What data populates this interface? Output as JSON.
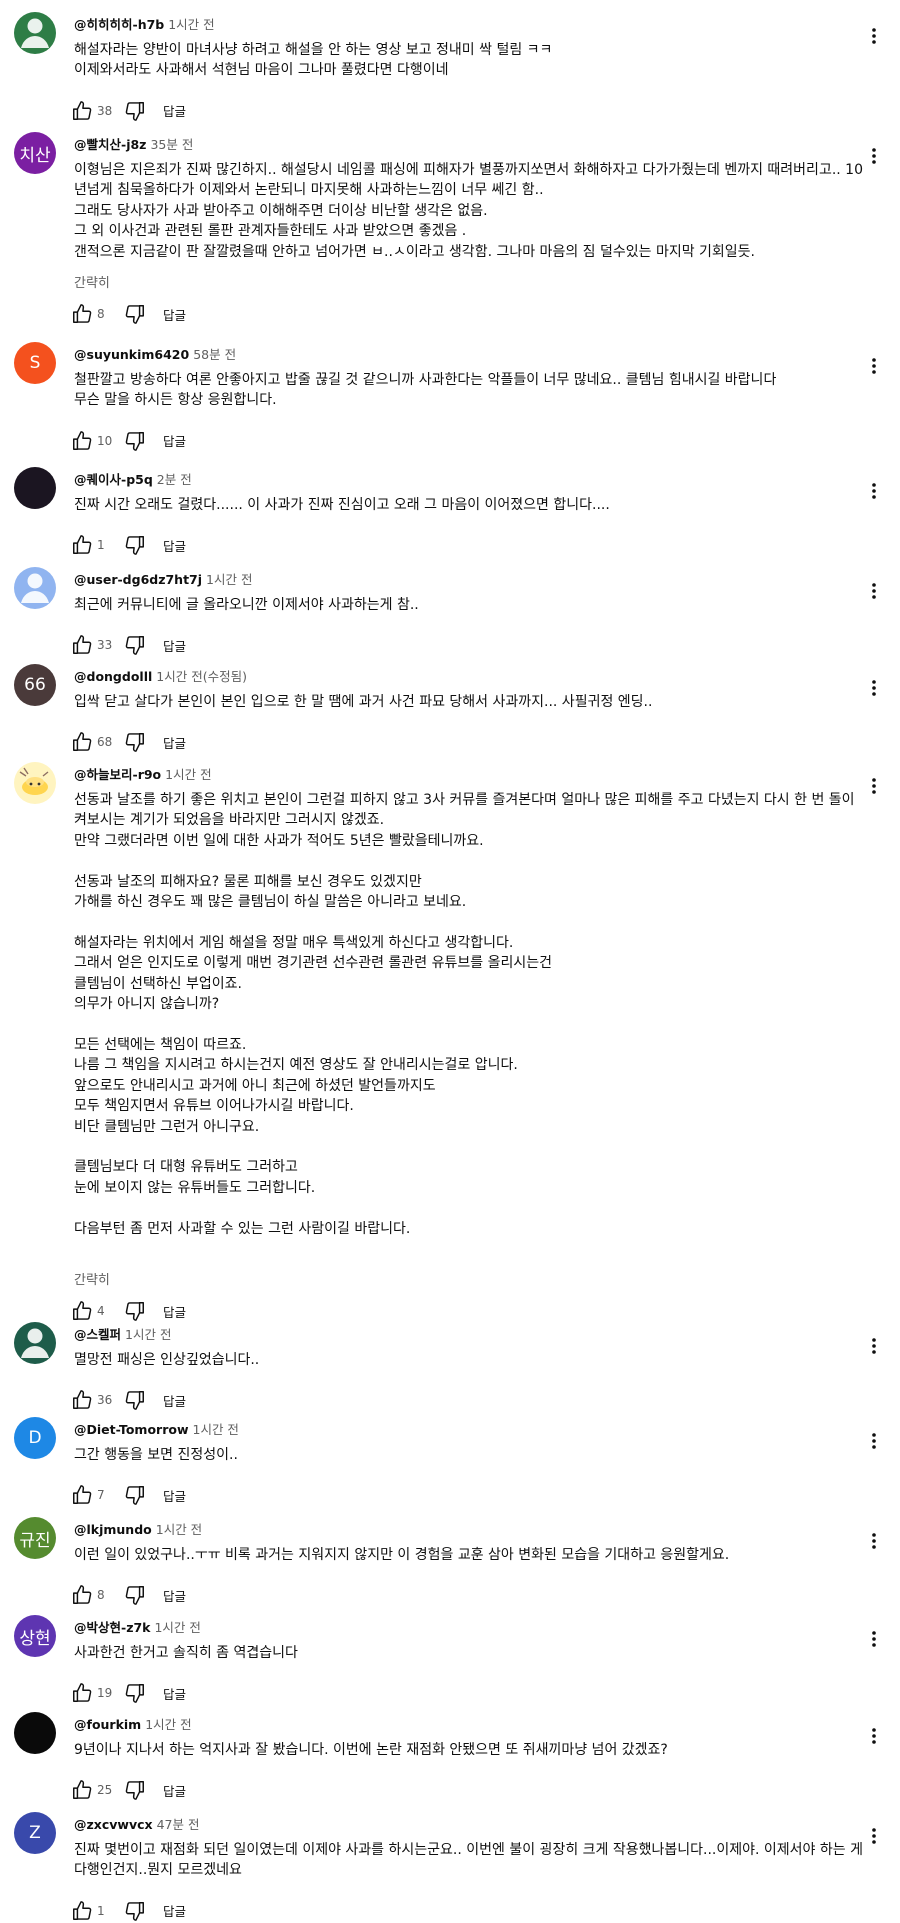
{
  "ui": {
    "reply_label": "답글",
    "show_less_label": "간략히"
  },
  "comments": [
    {
      "handle": "@히히히히-h7b",
      "time": "1시간 전",
      "avatar_text": "",
      "avatar_color": "#2e7d46",
      "avatar_icon": "person-icon",
      "text": "해설자라는 양반이 마녀사냥 하려고 해설을 안 하는 영상 보고 정내미 싹 털림 ㅋㅋ\n이제와서라도 사과해서 석현님 마음이 그나마 풀렸다면 다행이네",
      "likes": "38",
      "show_less": false
    },
    {
      "handle": "@빨치산-j8z",
      "time": "35분 전",
      "avatar_text": "치산",
      "avatar_color": "#7b1fa2",
      "avatar_icon": "",
      "text": "이형님은 지은죄가 진짜 많긴하지.. 해설당시 네임콜 패싱에 피해자가 별풍까지쏘면서 화해하자고 다가가줬는데 벤까지 때려버리고.. 10년넘게 침묵올하다가 이제와서 논란되니 마지못해 사과하는느낌이 너무 쎄긴 함..\n그래도 당사자가 사과 받아주고 이해해주면 더이상 비난할 생각은 없음.\n그 외 이사건과 관련된 롤판 관계자들한테도 사과 받았으면 좋겠음 .\n갠적으론 지금같이 판 잘깔렸을때 안하고 넘어가면 ㅂ..ㅅ이라고 생각함. 그나마 마음의 짐 덜수있는 마지막 기회일듯.",
      "likes": "8",
      "show_less": true
    },
    {
      "handle": "@suyunkim6420",
      "time": "58분 전",
      "avatar_text": "S",
      "avatar_color": "#f4511e",
      "avatar_icon": "",
      "text": "철판깔고 방송하다 여론 안좋아지고 밥줄 끊길 것 같으니까 사과한다는 악플들이 너무 많네요.. 클템님 힘내시길 바랍니다\n무슨 말을 하시든 항상 응원합니다.",
      "likes": "10",
      "show_less": false
    },
    {
      "handle": "@퀘이사-p5q",
      "time": "2분 전",
      "avatar_text": "",
      "avatar_color": "#1b1521",
      "avatar_icon": "",
      "text": "진짜 시간 오래도 걸렸다...... 이 사과가 진짜 진심이고 오래 그 마음이 이어졌으면 합니다....",
      "likes": "1",
      "show_less": false
    },
    {
      "handle": "@user-dg6dz7ht7j",
      "time": "1시간 전",
      "avatar_text": "",
      "avatar_color": "#90b4f0",
      "avatar_icon": "person-icon",
      "text": "최근에 커뮤니티에 글 올라오니깐 이제서야 사과하는게 참..",
      "likes": "33",
      "show_less": false
    },
    {
      "handle": "@dongdolll",
      "time": "1시간 전(수정됨)",
      "avatar_text": "66",
      "avatar_color": "#4a3a3a",
      "avatar_icon": "",
      "text": "입싹 닫고 살다가 본인이 본인 입으로 한 말 땜에 과거 사건 파묘 당해서 사과까지... 사필귀정 엔딩..",
      "likes": "68",
      "show_less": false
    },
    {
      "handle": "@하늘보리-r9o",
      "time": "1시간 전",
      "avatar_text": "",
      "avatar_color": "#fff4c0",
      "avatar_icon": "egg-icon",
      "text": "선동과 날조를 하기 좋은 위치고 본인이 그런걸 피하지 않고 3사 커뮤를 즐겨본다며 얼마나 많은 피해를 주고 다녔는지 다시 한 번 돌이켜보시는 계기가 되었음을 바라지만 그러시지 않겠죠.\n만약 그랬더라면 이번 일에 대한 사과가 적어도 5년은 빨랐을테니까요.\n\n선동과 날조의 피해자요? 물론 피해를 보신 경우도 있겠지만\n가해를 하신 경우도 꽤 많은 클템님이 하실 말씀은 아니라고 보네요.\n\n해설자라는 위치에서 게임 해설을 정말 매우 특색있게 하신다고 생각합니다.\n그래서 얻은 인지도로 이렇게 매번 경기관련 선수관련 롤관련 유튜브를 올리시는건\n클템님이 선택하신 부업이죠.\n의무가 아니지 않습니까?\n\n모든 선택에는 책임이 따르죠.\n나름 그 책임을 지시려고 하시는건지 예전 영상도 잘 안내리시는걸로 압니다.\n앞으로도 안내리시고 과거에 아니 최근에 하셨던 발언들까지도\n모두 책임지면서 유튜브 이어나가시길 바랍니다.\n비단 클템님만 그런거 아니구요.\n\n클템님보다 더 대형 유튜버도 그러하고\n눈에 보이지 않는 유튜버들도 그러합니다.\n\n다음부턴 좀 먼저 사과할 수 있는 그런 사람이길 바랍니다.",
      "likes": "4",
      "show_less": true
    },
    {
      "handle": "@스켈퍼",
      "time": "1시간 전",
      "avatar_text": "",
      "avatar_color": "#1e5c4a",
      "avatar_icon": "person-icon",
      "text": "멸망전 패싱은 인상깊었습니다..",
      "likes": "36",
      "show_less": false
    },
    {
      "handle": "@Diet-Tomorrow",
      "time": "1시간 전",
      "avatar_text": "D",
      "avatar_color": "#1e88e5",
      "avatar_icon": "",
      "text": "그간 행동을 보면 진정성이..",
      "likes": "7",
      "show_less": false
    },
    {
      "handle": "@lkjmundo",
      "time": "1시간 전",
      "avatar_text": "규진",
      "avatar_color": "#558b2f",
      "avatar_icon": "",
      "text": "이런 일이 있었구나..ㅜㅠ 비록 과거는 지워지지 않지만 이 경험을 교훈 삼아 변화된 모습을 기대하고 응원할게요.",
      "likes": "8",
      "show_less": false
    },
    {
      "handle": "@박상현-z7k",
      "time": "1시간 전",
      "avatar_text": "상현",
      "avatar_color": "#5e35b1",
      "avatar_icon": "",
      "text": "사과한건 한거고 솔직히 좀 역겹습니다",
      "likes": "19",
      "show_less": false
    },
    {
      "handle": "@fourkim",
      "time": "1시간 전",
      "avatar_text": "",
      "avatar_color": "#0a0a0a",
      "avatar_icon": "",
      "text": "9년이나 지나서 하는 억지사과 잘 봤습니다. 이번에 논란 재점화 안됐으면 또 쥐새끼마냥 넘어 갔겠죠?",
      "likes": "25",
      "show_less": false
    },
    {
      "handle": "@zxcvwvcx",
      "time": "47분 전",
      "avatar_text": "Z",
      "avatar_color": "#3949ab",
      "avatar_icon": "",
      "text": "진짜 몇번이고 재점화 되던 일이였는데 이제야 사과를 하시는군요.. 이번엔 불이 굉장히 크게 작용했나봅니다...이제야. 이제서야 하는 게 다행인건지..뭔지 모르겠네요",
      "likes": "1",
      "show_less": false
    }
  ]
}
